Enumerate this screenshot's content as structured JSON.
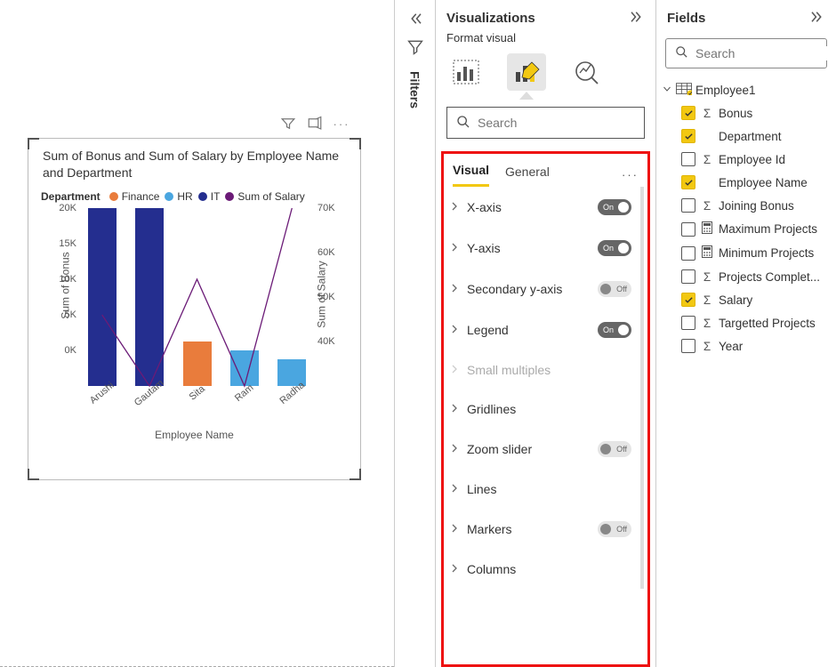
{
  "chart_data": {
    "type": "bar+line",
    "title": "Sum of Bonus and Sum of Salary by Employee Name and Department",
    "xlabel": "Employee Name",
    "ylabel_left": "Sum of Bonus",
    "ylabel_right": "Sum of Salary",
    "ylim_left": [
      0,
      20000
    ],
    "ylim_right": [
      40000,
      70000
    ],
    "y_ticks_left": [
      "20K",
      "15K",
      "10K",
      "5K",
      "0K"
    ],
    "y_ticks_right": [
      "70K",
      "60K",
      "50K",
      "40K"
    ],
    "categories": [
      "Arushi",
      "Gautam",
      "Sita",
      "Ram",
      "Radha"
    ],
    "legend_title": "Department",
    "series_bar": [
      {
        "name": "Finance",
        "color": "#e97c3c",
        "values": [
          null,
          null,
          5000,
          null,
          null
        ]
      },
      {
        "name": "HR",
        "color": "#4aa6e0",
        "values": [
          null,
          null,
          null,
          4000,
          3000
        ]
      },
      {
        "name": "IT",
        "color": "#242e8f",
        "values": [
          20000,
          20000,
          null,
          null,
          null
        ]
      }
    ],
    "series_line": [
      {
        "name": "Sum of Salary",
        "color": "#6b1b77",
        "values": [
          52000,
          40000,
          58000,
          40000,
          70000
        ]
      }
    ]
  },
  "canvas": {
    "filter_label": "Filters"
  },
  "vis": {
    "header": "Visualizations",
    "subheader": "Format visual",
    "search_placeholder": "Search",
    "tabs": {
      "visual": "Visual",
      "general": "General"
    },
    "items": [
      {
        "label": "X-axis",
        "toggle": "on"
      },
      {
        "label": "Y-axis",
        "toggle": "on"
      },
      {
        "label": "Secondary y-axis",
        "toggle": "off"
      },
      {
        "label": "Legend",
        "toggle": "on"
      },
      {
        "label": "Small multiples",
        "toggle": null,
        "disabled": true
      },
      {
        "label": "Gridlines",
        "toggle": null
      },
      {
        "label": "Zoom slider",
        "toggle": "off"
      },
      {
        "label": "Lines",
        "toggle": null
      },
      {
        "label": "Markers",
        "toggle": "off"
      },
      {
        "label": "Columns",
        "toggle": null
      }
    ]
  },
  "fields": {
    "header": "Fields",
    "search_placeholder": "Search",
    "table": "Employee1",
    "items": [
      {
        "name": "Bonus",
        "checked": true,
        "icon": "sigma"
      },
      {
        "name": "Department",
        "checked": true,
        "icon": ""
      },
      {
        "name": "Employee Id",
        "checked": false,
        "icon": "sigma"
      },
      {
        "name": "Employee Name",
        "checked": true,
        "icon": ""
      },
      {
        "name": "Joining Bonus",
        "checked": false,
        "icon": "sigma"
      },
      {
        "name": "Maximum Projects",
        "checked": false,
        "icon": "calc"
      },
      {
        "name": "Minimum Projects",
        "checked": false,
        "icon": "calc"
      },
      {
        "name": "Projects Complet...",
        "checked": false,
        "icon": "sigma"
      },
      {
        "name": "Salary",
        "checked": true,
        "icon": "sigma"
      },
      {
        "name": "Targetted Projects",
        "checked": false,
        "icon": "sigma"
      },
      {
        "name": "Year",
        "checked": false,
        "icon": "sigma"
      }
    ]
  },
  "toggle_text": {
    "on": "On",
    "off": "Off"
  }
}
